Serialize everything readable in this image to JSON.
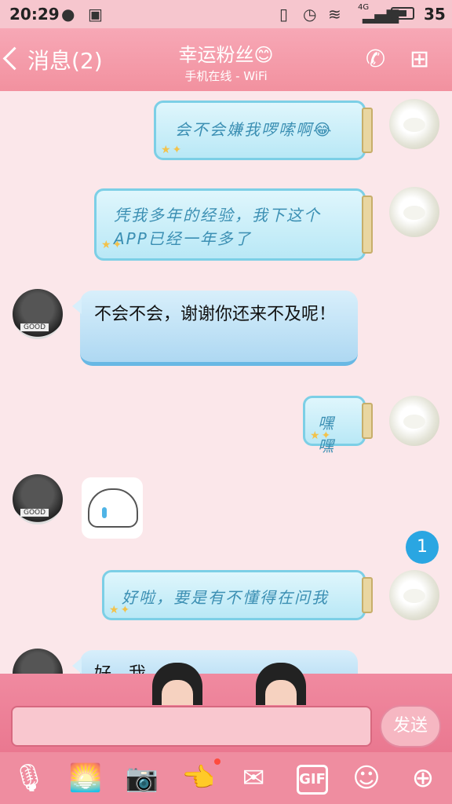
{
  "status_bar": {
    "time": "20:29",
    "network": "4G",
    "battery": "35",
    "icons": [
      "chat-bubble-icon",
      "image-icon",
      "vibrate-icon",
      "alarm-icon",
      "wifi-icon",
      "signal-icon",
      "battery-icon"
    ]
  },
  "header": {
    "back_label": "消息(2)",
    "title": "幸运粉丝😊",
    "subtitle": "手机在线 - WiFi",
    "icons": [
      "phone-icon",
      "profile-icon"
    ]
  },
  "messages": [
    {
      "from": "me",
      "type": "text",
      "text": "会不会嫌我啰嗦啊😂"
    },
    {
      "from": "me",
      "type": "text",
      "text": "凭我多年的经验，我下这个APP已经一年多了"
    },
    {
      "from": "other",
      "type": "text",
      "text": "不会不会，谢谢你还来不及呢！"
    },
    {
      "from": "me",
      "type": "text",
      "text": "嘿嘿"
    },
    {
      "from": "other",
      "type": "sticker",
      "icon": "crying-bun-sticker"
    },
    {
      "from": "me",
      "type": "text",
      "text": "好啦，要是有不懂得在问我"
    },
    {
      "from": "other",
      "type": "text",
      "text": "好，我..."
    }
  ],
  "unread_badge": "1",
  "composer": {
    "input_value": "",
    "send_label": "发送"
  },
  "toolbar_icons": [
    "microphone-icon",
    "picture-icon",
    "camera-icon",
    "hand-icon",
    "envelope-icon",
    "gif-icon",
    "emoji-icon",
    "plus-icon"
  ],
  "toolbar_gif_label": "GIF",
  "colors": {
    "accent": "#f2919f",
    "bubble_blue": "#aed8f2",
    "jar_border": "#7ccfe6",
    "badge": "#2aa6e2"
  }
}
